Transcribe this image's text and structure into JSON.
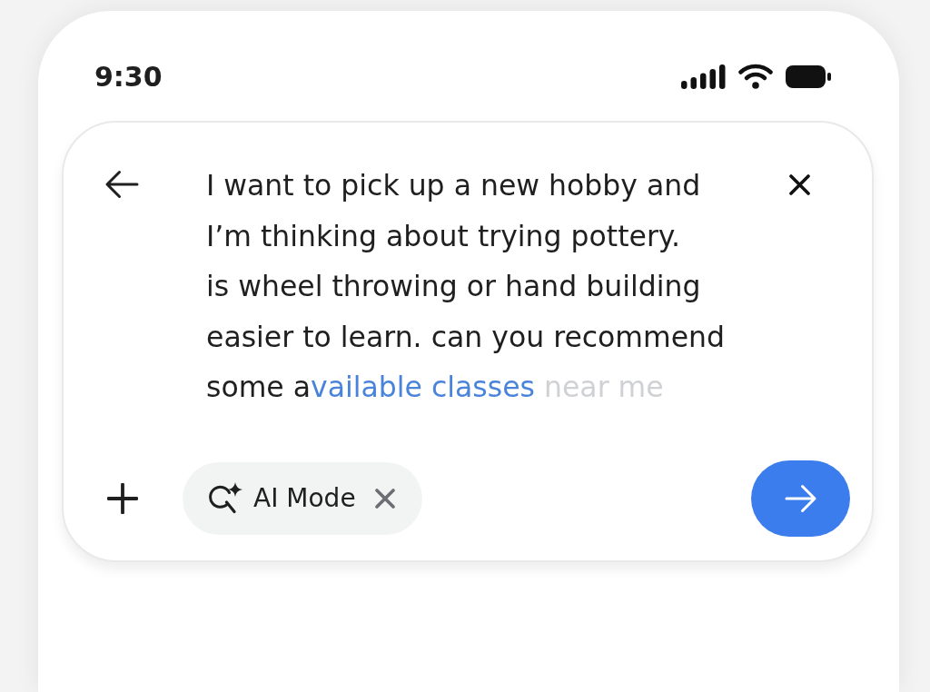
{
  "status_bar": {
    "time": "9:30"
  },
  "search_box": {
    "query": {
      "lines": [
        {
          "parts": [
            {
              "kind": "typed",
              "text": "I want to pick up a new hobby and"
            }
          ]
        },
        {
          "parts": [
            {
              "kind": "typed",
              "text": "I’m thinking about trying pottery."
            }
          ]
        },
        {
          "parts": [
            {
              "kind": "typed",
              "text": "is wheel throwing or hand building"
            }
          ]
        },
        {
          "parts": [
            {
              "kind": "typed",
              "text": "easier to learn. can you recommend"
            }
          ]
        },
        {
          "parts": [
            {
              "kind": "typed",
              "text": "some a"
            },
            {
              "kind": "appearing",
              "text": "vailable classes"
            },
            {
              "kind": "ghost",
              "text": " near me"
            }
          ]
        }
      ]
    },
    "mode_chip": {
      "label": "AI Mode"
    }
  }
}
